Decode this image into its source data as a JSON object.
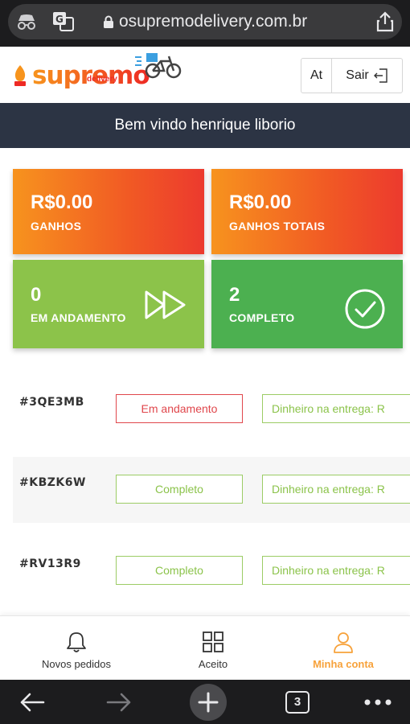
{
  "browser": {
    "url": "osupremodelivery.com.br",
    "tab_count": "3"
  },
  "header": {
    "logo_text": "supremo",
    "logo_sub": "delivery",
    "at_label": "At",
    "logout_label": "Sair"
  },
  "welcome": "Bem vindo henrique liborio",
  "stats": [
    {
      "value": "R$0.00",
      "label": "GANHOS"
    },
    {
      "value": "R$0.00",
      "label": "GANHOS TOTAIS"
    },
    {
      "value": "0",
      "label": "EM ANDAMENTO"
    },
    {
      "value": "2",
      "label": "COMPLETO"
    }
  ],
  "orders": [
    {
      "id": "#3QE3MB",
      "status": "Em andamento",
      "payment": "Dinheiro na entrega: R"
    },
    {
      "id": "#KBZK6W",
      "status": "Completo",
      "payment": "Dinheiro na entrega: R"
    },
    {
      "id": "#RV13R9",
      "status": "Completo",
      "payment": "Dinheiro na entrega: R"
    }
  ],
  "nav": [
    {
      "label": "Novos pedidos",
      "icon": "bell-icon"
    },
    {
      "label": "Aceito",
      "icon": "grid-icon"
    },
    {
      "label": "Minha conta",
      "icon": "user-icon"
    }
  ],
  "colors": {
    "accent": "#f7a23b",
    "header_bar": "#2c3444",
    "card_orange": "#f15a24",
    "card_light_green": "#8cc34a",
    "card_green": "#4cb050",
    "status_red": "#e0474c"
  }
}
